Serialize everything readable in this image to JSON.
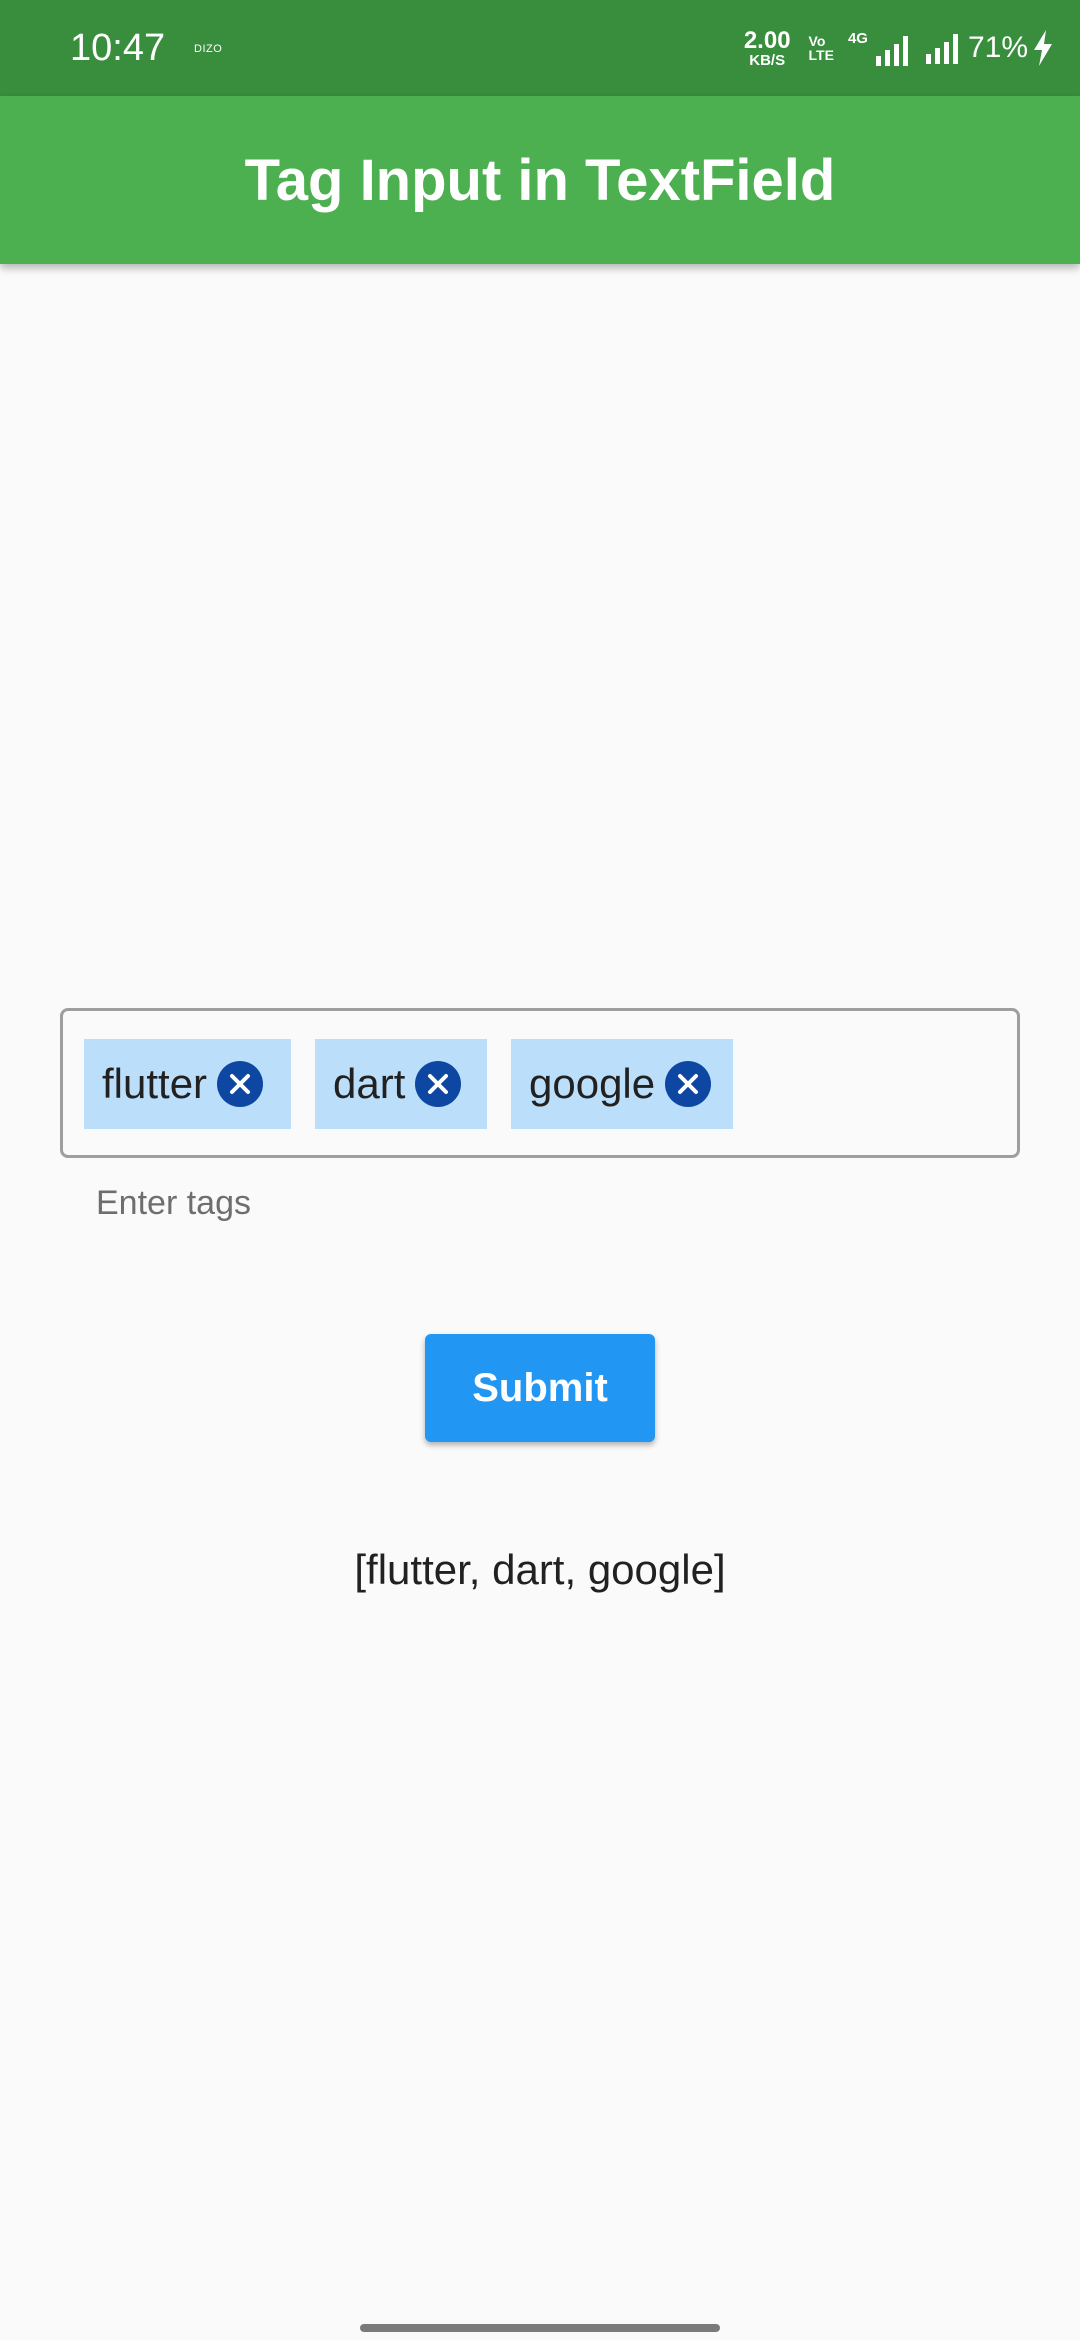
{
  "status_bar": {
    "time": "10:47",
    "carrier_badge": "DIZO",
    "net_speed_value": "2.00",
    "net_speed_unit": "KB/S",
    "volte_top": "Vo",
    "volte_bottom": "LTE",
    "network_type": "4G",
    "battery": "71%",
    "icons": [
      "volte-icon",
      "4g-signal-icon",
      "signal-icon",
      "charging-bolt-icon"
    ]
  },
  "app_bar": {
    "title": "Tag Input in TextField",
    "color": "#4CAF50"
  },
  "tag_input": {
    "tags": [
      {
        "label": "flutter",
        "remove_icon": "close-circle-icon"
      },
      {
        "label": "dart",
        "remove_icon": "close-circle-icon"
      },
      {
        "label": "google",
        "remove_icon": "close-circle-icon"
      }
    ],
    "helper_text": "Enter tags",
    "tag_color": "#BBDEFB",
    "remove_icon_color": "#0D47A1"
  },
  "submit_button": {
    "label": "Submit",
    "color": "#2196F3"
  },
  "output_text": "[flutter, dart, google]"
}
